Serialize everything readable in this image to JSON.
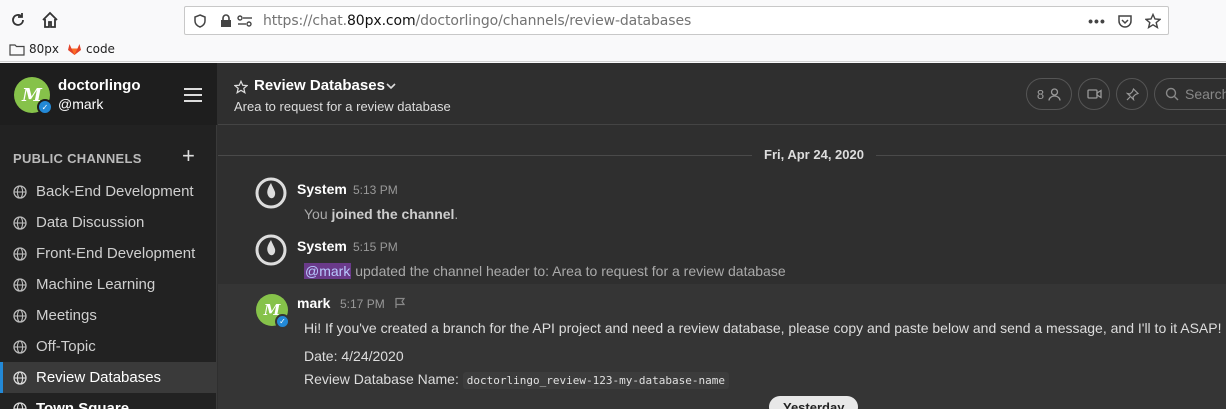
{
  "browser": {
    "url_prefix": "https://chat.",
    "url_host": "80px.com",
    "url_path": "/doctorlingo/channels/review-databases",
    "bookmarks": [
      {
        "label": "80px"
      },
      {
        "label": "code"
      }
    ]
  },
  "team": {
    "name": "doctorlingo",
    "username": "@mark",
    "avatar_letter": "M"
  },
  "sidebar": {
    "section_title": "PUBLIC CHANNELS",
    "add_symbol": "+",
    "channels": [
      {
        "label": "Back-End Development"
      },
      {
        "label": "Data Discussion"
      },
      {
        "label": "Front-End Development"
      },
      {
        "label": "Machine Learning"
      },
      {
        "label": "Meetings"
      },
      {
        "label": "Off-Topic"
      },
      {
        "label": "Review Databases"
      },
      {
        "label": "Town Square"
      }
    ]
  },
  "channel": {
    "title": "Review Databases",
    "purpose": "Area to request for a review database",
    "member_count": "8",
    "search_placeholder": "Search"
  },
  "date_separator": "Fri, Apr 24, 2020",
  "posts": [
    {
      "author": "System",
      "time": "5:13 PM",
      "text_pre": "You ",
      "text_bold": "joined the channel",
      "text_post": "."
    },
    {
      "author": "System",
      "time": "5:15 PM",
      "mention": "@mark",
      "text": " updated the channel header to: Area to request for a review database"
    },
    {
      "author": "mark",
      "time": "5:17 PM",
      "message": "Hi! If you've created a branch for the API project and need a review database, please copy and paste below and send a message, and I'll to it ASAP!",
      "date_line": "Date: 4/24/2020",
      "db_label": "Review Database Name: ",
      "db_code": "doctorlingo_review-123-my-database-name"
    }
  ],
  "next_date_separator": "Yesterday",
  "colors": {
    "accent": "#2389d7",
    "avatar": "#86c24a",
    "mention_bg": "#6a3a8a"
  }
}
